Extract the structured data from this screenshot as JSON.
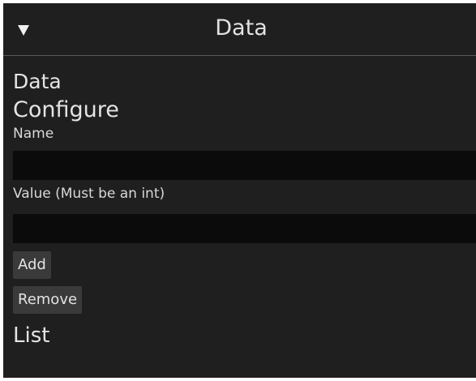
{
  "header": {
    "title": "Data",
    "toggle_icon": "triangle-down-icon"
  },
  "main": {
    "section_title": "Data",
    "subsection_title": "Configure",
    "name_label": "Name",
    "name_value": "",
    "value_label": "Value (Must be an int)",
    "value_value": "",
    "add_label": "Add",
    "remove_label": "Remove",
    "list_title": "List"
  },
  "colors": {
    "panel_bg": "#1f1f1f",
    "input_bg": "#0b0b0b",
    "button_bg": "#3a3a3a",
    "text": "#e6e6e6",
    "divider": "#5a5a5a"
  }
}
